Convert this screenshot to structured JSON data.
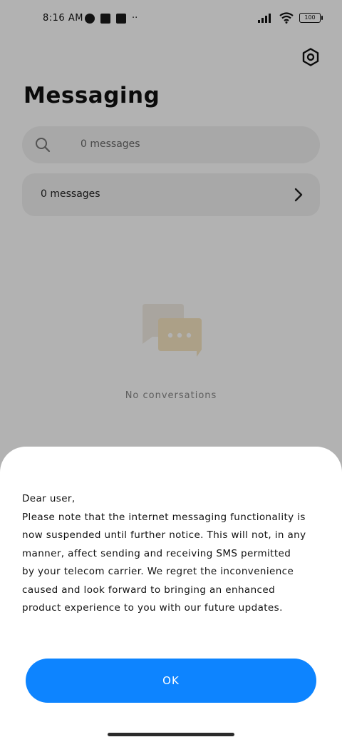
{
  "status_bar": {
    "time": "8:16 AM",
    "battery": "100"
  },
  "header": {
    "title": "Messaging",
    "settings_icon": "gear-hex-icon"
  },
  "search": {
    "placeholder": "0 messages",
    "icon": "search-icon"
  },
  "messages_row": {
    "label": "0 messages",
    "icon": "chevron-right-icon"
  },
  "empty_state": {
    "icon": "chat-bubbles-icon",
    "text": "No conversations"
  },
  "dialog": {
    "lines": [
      "Dear user,",
      "Please note that the internet messaging functionality is",
      "now suspended until further notice. This will not, in any",
      "manner, affect sending and receiving SMS permitted",
      "by your telecom carrier. We regret the inconvenience",
      "caused and look forward to bringing an enhanced",
      "product experience to you with our future updates."
    ],
    "ok_label": "OK"
  },
  "colors": {
    "accent": "#0d84ff",
    "scrim": "rgba(0,0,0,0.30)"
  }
}
